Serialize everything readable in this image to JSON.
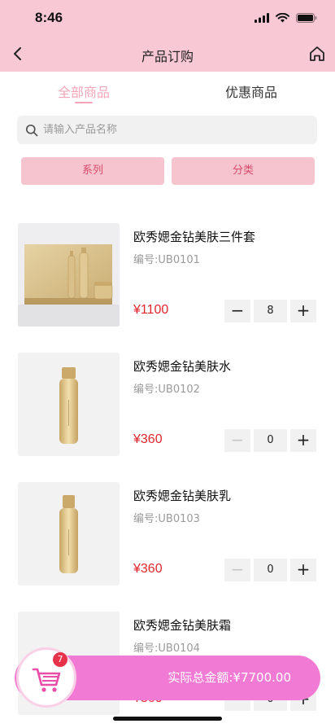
{
  "status_bar": {
    "time": "8:46"
  },
  "navbar": {
    "title": "产品订购"
  },
  "tabs": [
    {
      "label": "全部商品",
      "active": true
    },
    {
      "label": "优惠商品",
      "active": false
    }
  ],
  "search": {
    "placeholder": "请输入产品名称"
  },
  "filters": [
    {
      "label": "系列"
    },
    {
      "label": "分类"
    }
  ],
  "products": [
    {
      "name": "欧秀媤金钻美肤三件套",
      "code": "编号:UB0101",
      "price": "¥1100",
      "qty": "8",
      "image_icon": "gift-set-box-image"
    },
    {
      "name": "欧秀媤金钻美肤水",
      "code": "编号:UB0102",
      "price": "¥360",
      "qty": "0",
      "image_icon": "bottle-image"
    },
    {
      "name": "欧秀媤金钻美肤乳",
      "code": "编号:UB0103",
      "price": "¥360",
      "qty": "0",
      "image_icon": "bottle-image"
    },
    {
      "name": "欧秀媤金钻美肤霜",
      "code": "编号:UB0104",
      "price": "¥360",
      "qty": "0",
      "image_icon": "cream-jar-image"
    }
  ],
  "cart": {
    "badge": "7",
    "total": "实际总金额:¥7700.00"
  },
  "colors": {
    "header": "#f8c9d4",
    "accent_pink": "#f4a6b8",
    "price_red": "#e0262d",
    "cart_bar": "#f17bd4"
  }
}
